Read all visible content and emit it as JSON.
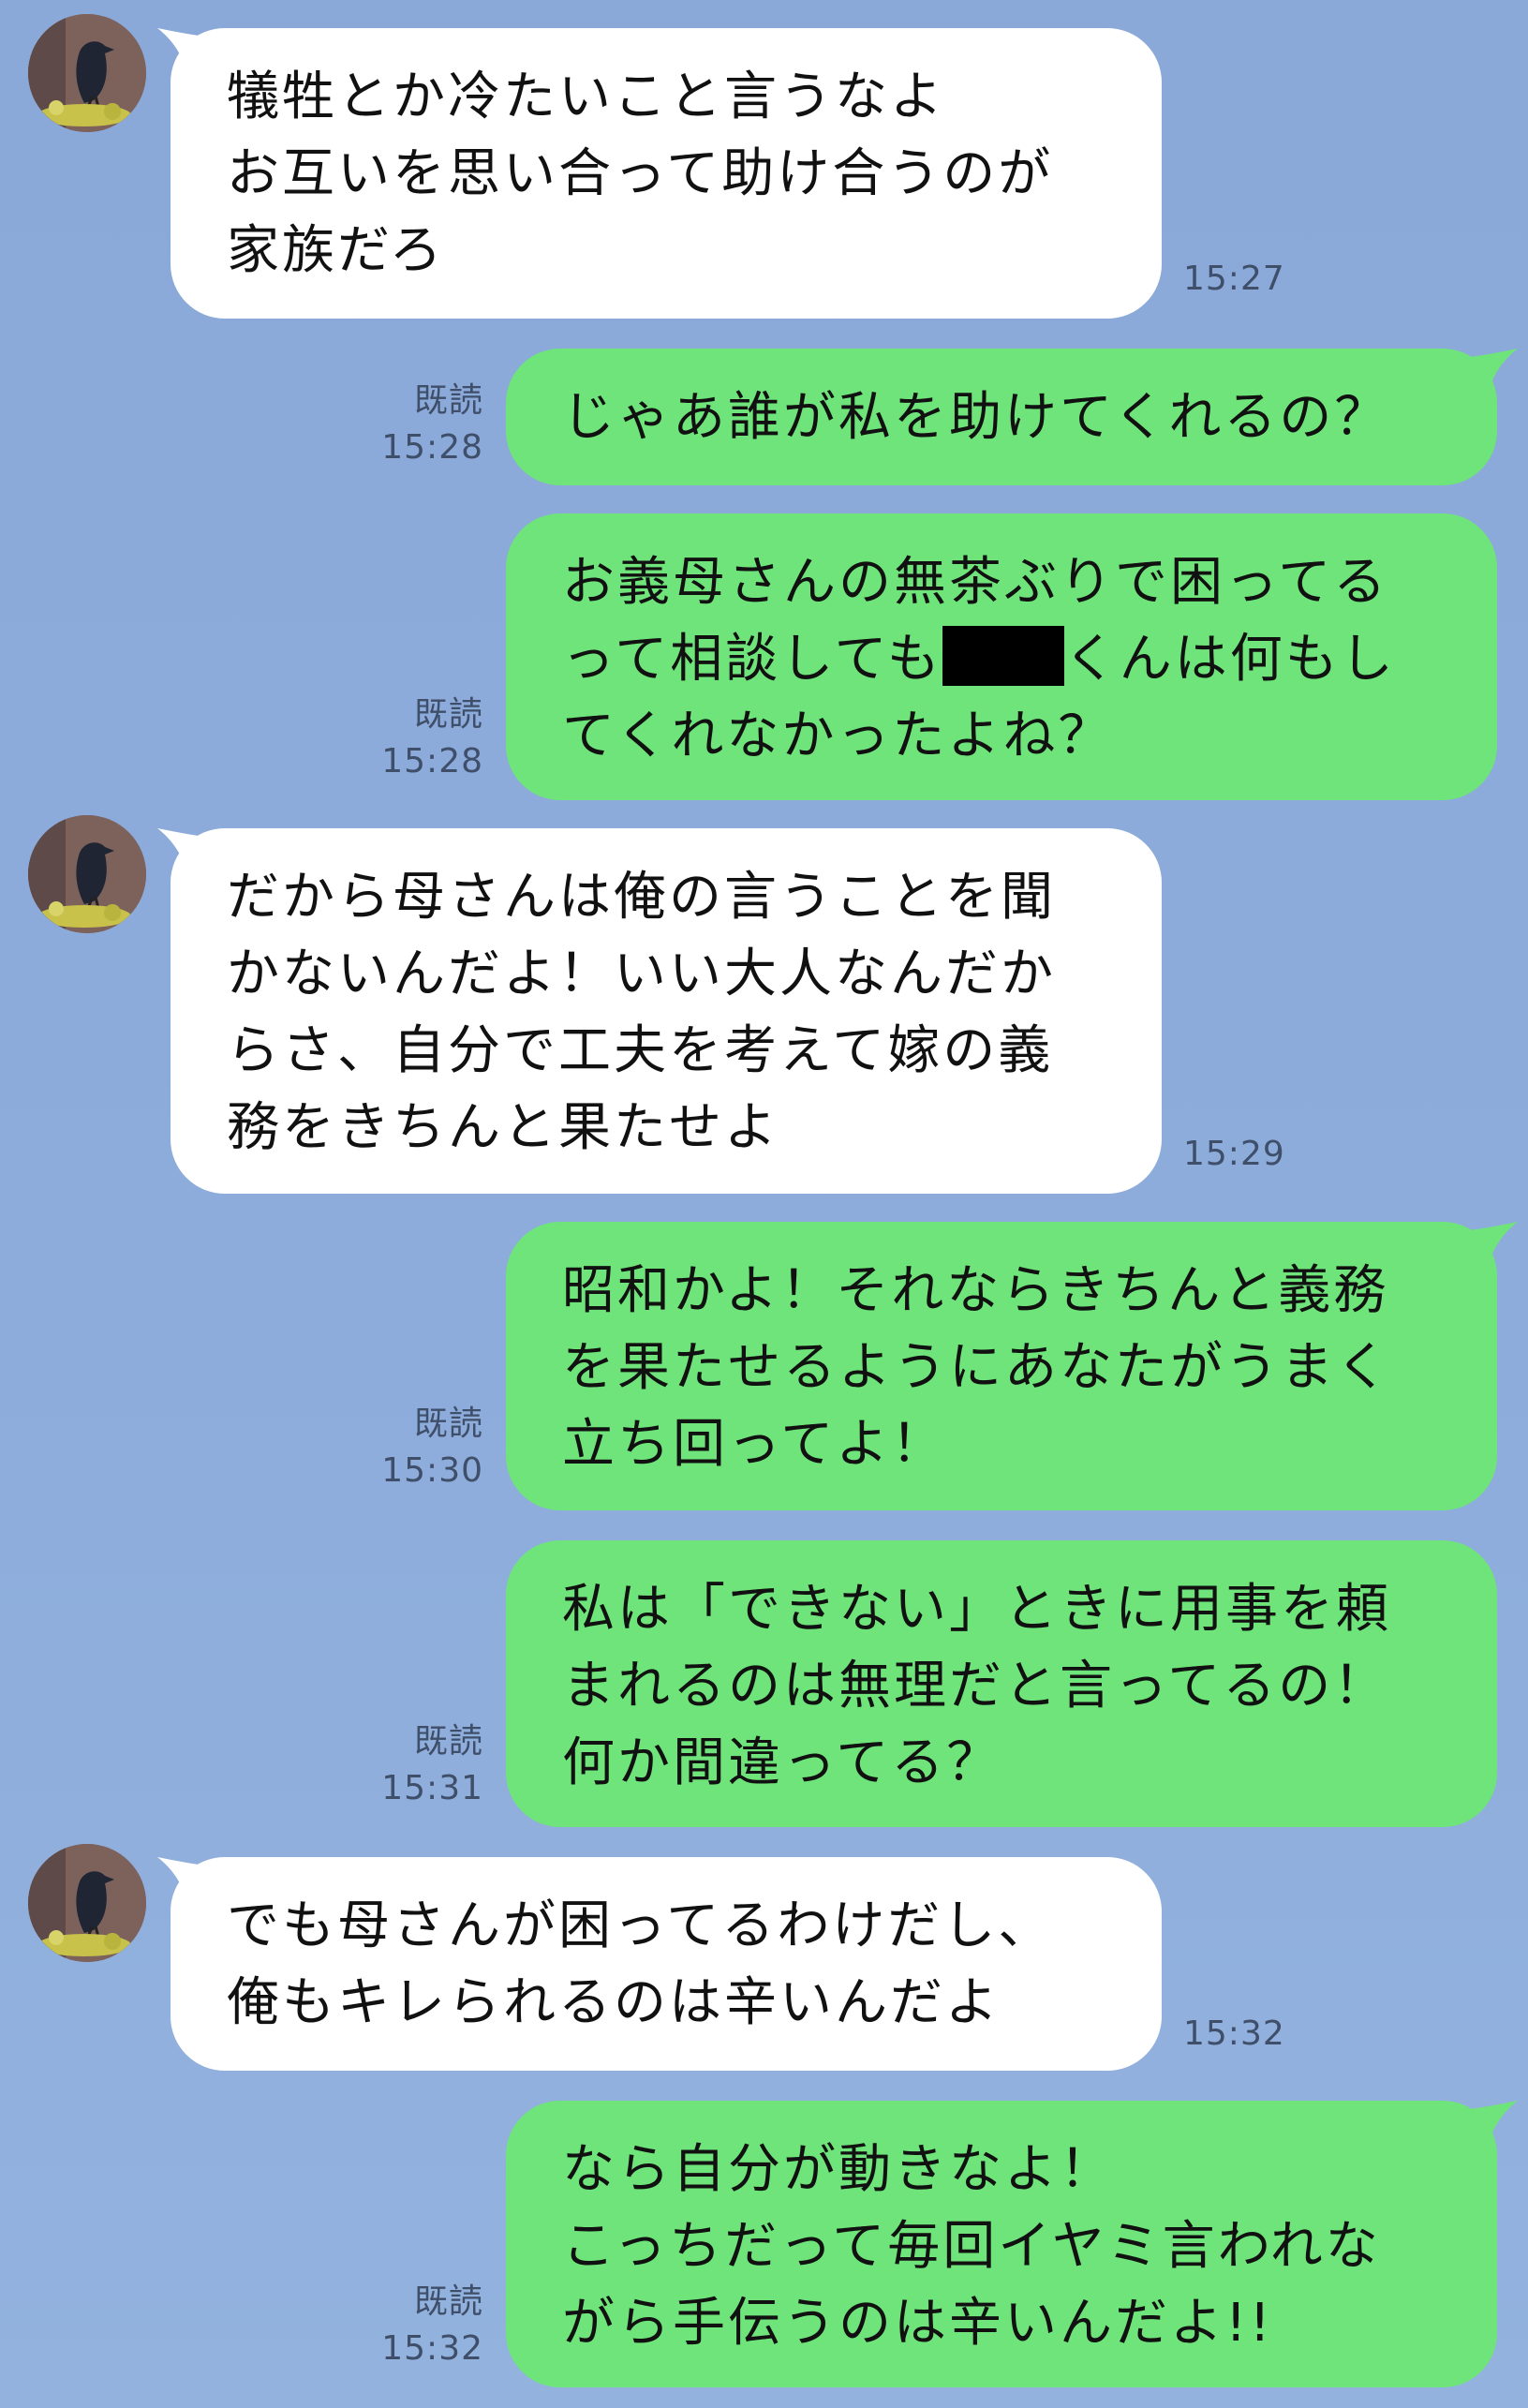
{
  "colors": {
    "background": "#8aa8d8",
    "incoming_bubble": "#ffffff",
    "outgoing_bubble": "#6fe47a",
    "meta_text": "#3f4f6a"
  },
  "messages": [
    {
      "sender": "them",
      "text": "犠牲とか冷たいこと言うなよ\nお互いを思い合って助け合うのが\n家族だろ",
      "time": "15:27"
    },
    {
      "sender": "me",
      "text": "じゃあ誰が私を助けてくれるの？",
      "read": "既読",
      "time": "15:28"
    },
    {
      "sender": "me",
      "text_before": "お義母さんの無茶ぶりで困ってる\nって相談しても",
      "redacted": "redacted-name",
      "text_after": "くんは何もし\nてくれなかったよね？",
      "read": "既読",
      "time": "15:28"
    },
    {
      "sender": "them",
      "text": "だから母さんは俺の言うことを聞\nかないんだよ！いい大人なんだか\nらさ、自分で工夫を考えて嫁の義\n務をきちんと果たせよ",
      "time": "15:29"
    },
    {
      "sender": "me",
      "text": "昭和かよ！それならきちんと義務\nを果たせるようにあなたがうまく\n立ち回ってよ！",
      "read": "既読",
      "time": "15:30"
    },
    {
      "sender": "me",
      "text": "私は「できない」ときに用事を頼\nまれるのは無理だと言ってるの！\n何か間違ってる？",
      "read": "既読",
      "time": "15:31"
    },
    {
      "sender": "them",
      "text": "でも母さんが困ってるわけだし、\n俺もキレられるのは辛いんだよ",
      "time": "15:32"
    },
    {
      "sender": "me",
      "text": "なら自分が動きなよ！\nこっちだって毎回イヤミ言われな\nがら手伝うのは辛いんだよ!!",
      "read": "既読",
      "time": "15:32"
    }
  ]
}
